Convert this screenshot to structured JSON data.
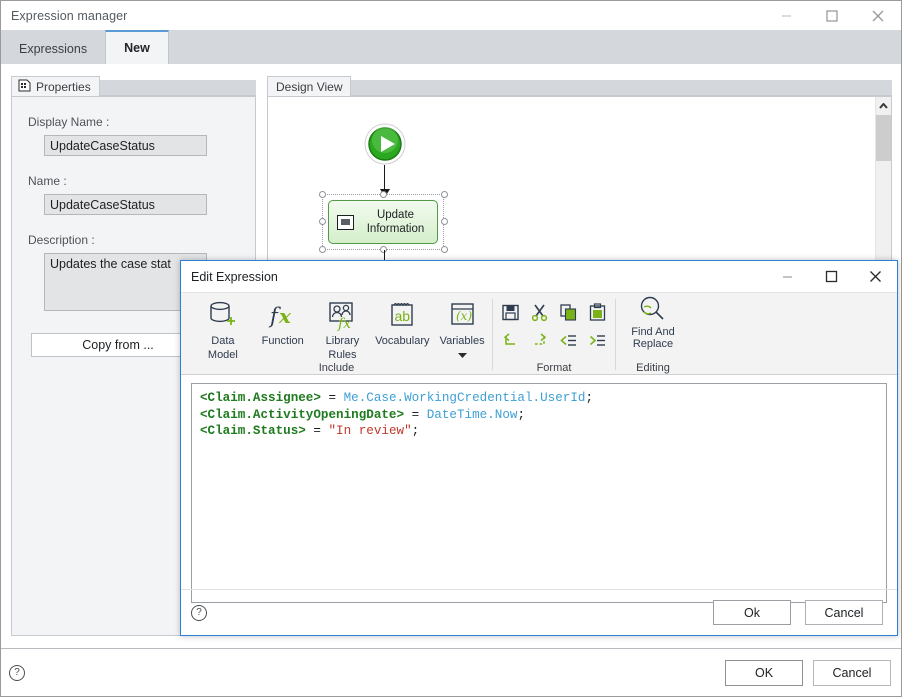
{
  "window": {
    "title": "Expression manager",
    "controls": {
      "minimize": "minimize-icon",
      "maximize": "maximize-icon",
      "close": "close-icon"
    },
    "tabs": [
      {
        "label": "Expressions",
        "active": false
      },
      {
        "label": "New",
        "active": true
      }
    ],
    "footer": {
      "help": "?",
      "ok_label": "OK",
      "cancel_label": "Cancel"
    }
  },
  "properties": {
    "tab_label": "Properties",
    "tab_icon": "properties-grid-icon",
    "fields": {
      "display_name_label": "Display Name :",
      "display_name_value": "UpdateCaseStatus",
      "name_label": "Name :",
      "name_value": "UpdateCaseStatus",
      "description_label": "Description :",
      "description_value": "Updates the case stat"
    },
    "copy_from_label": "Copy from ..."
  },
  "design_view": {
    "tab_label": "Design View",
    "start_node": "start-node-icon",
    "activity": {
      "icon": "update-information-icon",
      "label_line1": "Update",
      "label_line2": "Information",
      "selected": true
    },
    "scrollbar": {
      "vertical_up_arrow": "chevron-up-icon",
      "horizontal_thumb": "h-scroll-thumb"
    }
  },
  "dialog": {
    "title": "Edit Expression",
    "controls": {
      "minimize": "minimize-icon",
      "maximize": "maximize-icon",
      "close": "close-icon"
    },
    "ribbon": {
      "groups": [
        {
          "name": "Include",
          "label": "Include",
          "items": [
            {
              "icon": "data-model-icon",
              "label_line1": "Data",
              "label_line2": "Model"
            },
            {
              "icon": "function-fx-icon",
              "label_line1": "Function",
              "label_line2": ""
            },
            {
              "icon": "library-rules-icon",
              "label_line1": "Library",
              "label_line2": "Rules"
            },
            {
              "icon": "vocabulary-ab-icon",
              "label_line1": "Vocabulary",
              "label_line2": ""
            },
            {
              "icon": "variables-x-icon",
              "label_line1": "Variables",
              "label_line2": "",
              "dropdown": true
            }
          ]
        },
        {
          "name": "Format",
          "label": "Format",
          "small_items": [
            {
              "icon": "save-icon"
            },
            {
              "icon": "cut-scissors-icon"
            },
            {
              "icon": "copy-icon"
            },
            {
              "icon": "paste-icon"
            },
            {
              "icon": "undo-icon"
            },
            {
              "icon": "redo-icon"
            },
            {
              "icon": "decrease-indent-icon"
            },
            {
              "icon": "increase-indent-icon"
            }
          ]
        },
        {
          "name": "Editing",
          "label": "Editing",
          "items": [
            {
              "icon": "find-and-replace-icon",
              "label_line1": "Find And",
              "label_line2": "Replace"
            }
          ]
        }
      ]
    },
    "editor": {
      "lines": [
        [
          {
            "text": "<Claim.Assignee>",
            "token": "tag"
          },
          {
            "text": " = ",
            "token": "op"
          },
          {
            "text": "Me.Case.WorkingCredential.UserId",
            "token": "ref"
          },
          {
            "text": ";",
            "token": "op"
          }
        ],
        [
          {
            "text": "<Claim.ActivityOpeningDate>",
            "token": "tag"
          },
          {
            "text": " = ",
            "token": "op"
          },
          {
            "text": "DateTime.Now",
            "token": "ref"
          },
          {
            "text": ";",
            "token": "op"
          }
        ],
        [
          {
            "text": "<Claim.Status>",
            "token": "tag"
          },
          {
            "text": " = ",
            "token": "op"
          },
          {
            "text": "\"In review\"",
            "token": "str"
          },
          {
            "text": ";",
            "token": "op"
          }
        ]
      ]
    },
    "footer": {
      "help": "?",
      "ok_label": "Ok",
      "cancel_label": "Cancel"
    }
  },
  "colors": {
    "accent_blue": "#2b7fd4",
    "tab_active_border": "#5b9bd5",
    "ribbon_icon_dark": "#2f3c4f",
    "ribbon_icon_green": "#7ab317",
    "node_green_border": "#4f9a43",
    "code_tag": "#1f7a1f",
    "code_ref": "#3e9fd6",
    "code_string": "#c0392b"
  }
}
